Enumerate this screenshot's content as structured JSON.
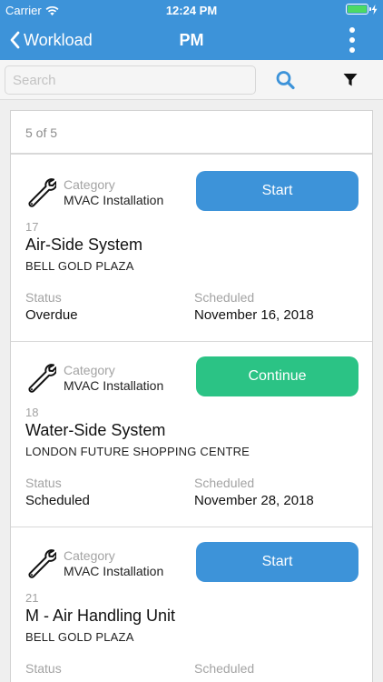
{
  "status_bar": {
    "carrier": "Carrier",
    "time": "12:24 PM",
    "battery_level": 1.0,
    "battery_color": "#4cd964"
  },
  "nav": {
    "back_label": "Workload",
    "title": "PM",
    "back_icon": "chevron-left-icon",
    "more_icon": "vertical-ellipsis-icon",
    "background": "#3d93d9"
  },
  "search": {
    "placeholder": "Search",
    "value": "",
    "search_icon": "magnifier-icon",
    "filter_icon": "funnel-icon"
  },
  "list": {
    "count": "5 of 5",
    "items": [
      {
        "category_label": "Category",
        "category": "MVAC Installation",
        "number": "17",
        "title": "Air-Side System",
        "location": "BELL GOLD PLAZA",
        "status_label": "Status",
        "status": "Overdue",
        "scheduled_label": "Scheduled",
        "scheduled": "November 16, 2018",
        "action": "Start",
        "action_color": "#3d93d9"
      },
      {
        "category_label": "Category",
        "category": "MVAC Installation",
        "number": "18",
        "title": "Water-Side System",
        "location": "LONDON FUTURE SHOPPING CENTRE",
        "status_label": "Status",
        "status": "Scheduled",
        "scheduled_label": "Scheduled",
        "scheduled": "November 28, 2018",
        "action": "Continue",
        "action_color": "#2bc385"
      },
      {
        "category_label": "Category",
        "category": "MVAC Installation",
        "number": "21",
        "title": "M - Air Handling Unit",
        "location": "BELL GOLD PLAZA",
        "status_label": "Status",
        "status": "",
        "scheduled_label": "Scheduled",
        "scheduled": "",
        "action": "Start",
        "action_color": "#3d93d9"
      }
    ]
  }
}
